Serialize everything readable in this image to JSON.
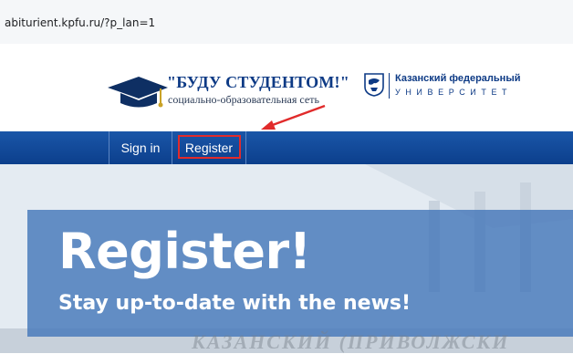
{
  "browser": {
    "url": "abiturient.kpfu.ru/?p_lan=1"
  },
  "header": {
    "brand_title": "\"БУДУ СТУДЕНТОМ!\"",
    "brand_subtitle": "социально-образовательная сеть",
    "university_line1": "Казанский федеральный",
    "university_line2": "УНИВЕРСИТЕТ"
  },
  "nav": {
    "items": [
      {
        "label": "Sign in"
      },
      {
        "label": "Register"
      }
    ]
  },
  "banner": {
    "title": "Register!",
    "subtitle": "Stay up-to-date with the news!",
    "carved_text": "КАЗАНСКИЙ (ПРИВОЛЖСКИ"
  },
  "colors": {
    "nav_background": "#0c3f8c",
    "brand_blue": "#0d3a85",
    "annotation_red": "#e12b2b",
    "banner_overlay": "#4678b9"
  },
  "icons": {
    "brand": "graduation-cap-icon",
    "university": "kfu-emblem-icon",
    "annotation": "red-arrow-icon"
  }
}
